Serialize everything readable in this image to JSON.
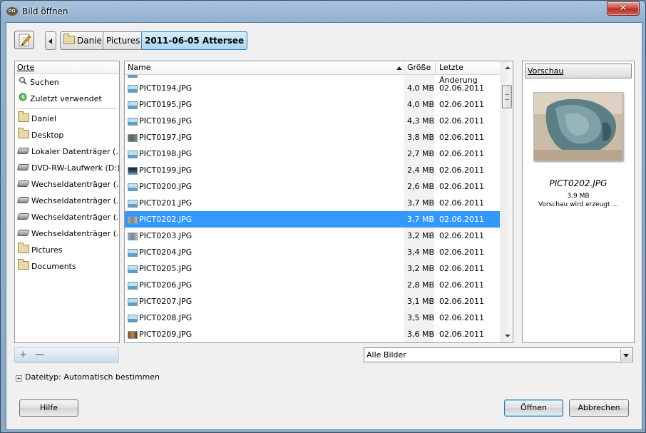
{
  "window": {
    "title": "Bild öffnen",
    "close_label": "✕"
  },
  "icons": {
    "app": "gimp-icon",
    "pencil": "pencil-icon",
    "back": "back-arrow-icon",
    "folder": "folder-icon"
  },
  "breadcrumbs": [
    {
      "label": "Daniel"
    },
    {
      "label": "Pictures"
    },
    {
      "label": "2011-06-05 Attersee"
    }
  ],
  "places": {
    "header": "Orte",
    "items": [
      {
        "label": "Suchen",
        "icon": "search-icon"
      },
      {
        "label": "Zuletzt verwendet",
        "icon": "recent-icon"
      },
      {
        "label": "Daniel",
        "icon": "folder-icon"
      },
      {
        "label": "Desktop",
        "icon": "folder-icon"
      },
      {
        "label": "Lokaler Datenträger (...",
        "icon": "harddisk-icon"
      },
      {
        "label": "DVD-RW-Laufwerk (D:)",
        "icon": "dvd-drive-icon"
      },
      {
        "label": "Wechseldatenträger (...",
        "icon": "removable-drive-icon"
      },
      {
        "label": "Wechseldatenträger (...",
        "icon": "removable-drive-icon"
      },
      {
        "label": "Wechseldatenträger (...",
        "icon": "removable-drive-icon"
      },
      {
        "label": "Wechseldatenträger (...",
        "icon": "removable-drive-icon"
      },
      {
        "label": "Pictures",
        "icon": "folder-icon"
      },
      {
        "label": "Documents",
        "icon": "folder-icon"
      }
    ],
    "add_label": "+",
    "remove_label": "—"
  },
  "file_list": {
    "columns": {
      "name": "Name",
      "size": "Größe",
      "modified": "Letzte Änderung"
    },
    "rows": [
      {
        "name": "PICT0194.JPG",
        "size": "4,0 MB",
        "date": "02.06.2011",
        "thumb": "sky"
      },
      {
        "name": "PICT0195.JPG",
        "size": "4,0 MB",
        "date": "02.06.2011",
        "thumb": "sky"
      },
      {
        "name": "PICT0196.JPG",
        "size": "4,3 MB",
        "date": "02.06.2011",
        "thumb": "sky"
      },
      {
        "name": "PICT0197.JPG",
        "size": "3,8 MB",
        "date": "02.06.2011",
        "thumb": "mixed"
      },
      {
        "name": "PICT0198.JPG",
        "size": "2,7 MB",
        "date": "02.06.2011",
        "thumb": "sky"
      },
      {
        "name": "PICT0199.JPG",
        "size": "2,4 MB",
        "date": "02.06.2011",
        "thumb": "dark"
      },
      {
        "name": "PICT0200.JPG",
        "size": "2,6 MB",
        "date": "02.06.2011",
        "thumb": "sky"
      },
      {
        "name": "PICT0201.JPG",
        "size": "3,7 MB",
        "date": "02.06.2011",
        "thumb": "sky"
      },
      {
        "name": "PICT0202.JPG",
        "size": "3,7 MB",
        "date": "02.06.2011",
        "thumb": "photo",
        "selected": true
      },
      {
        "name": "PICT0203.JPG",
        "size": "3,2 MB",
        "date": "02.06.2011",
        "thumb": "photo"
      },
      {
        "name": "PICT0204.JPG",
        "size": "3,4 MB",
        "date": "02.06.2011",
        "thumb": "sky"
      },
      {
        "name": "PICT0205.JPG",
        "size": "3,2 MB",
        "date": "02.06.2011",
        "thumb": "sky"
      },
      {
        "name": "PICT0206.JPG",
        "size": "2,8 MB",
        "date": "02.06.2011",
        "thumb": "sky"
      },
      {
        "name": "PICT0207.JPG",
        "size": "3,1 MB",
        "date": "02.06.2011",
        "thumb": "sky"
      },
      {
        "name": "PICT0208.JPG",
        "size": "3,5 MB",
        "date": "02.06.2011",
        "thumb": "sky"
      },
      {
        "name": "PICT0209.JPG",
        "size": "3,6 MB",
        "date": "02.06.2011",
        "thumb": "brown"
      }
    ]
  },
  "preview": {
    "button_label": "Vorschau",
    "filename": "PICT0202.JPG",
    "size": "3,9 MB",
    "status": "Vorschau wird erzeugt ..."
  },
  "filter": {
    "selected": "Alle Bilder"
  },
  "filetype": {
    "expander": "+",
    "label": "Dateityp: Automatisch bestimmen"
  },
  "buttons": {
    "help": "Hilfe",
    "open": "Öffnen",
    "cancel": "Abbrechen"
  },
  "colors": {
    "selection": "#3399ff",
    "titlebar": "#a9c3dd",
    "close": "#c8463a"
  }
}
